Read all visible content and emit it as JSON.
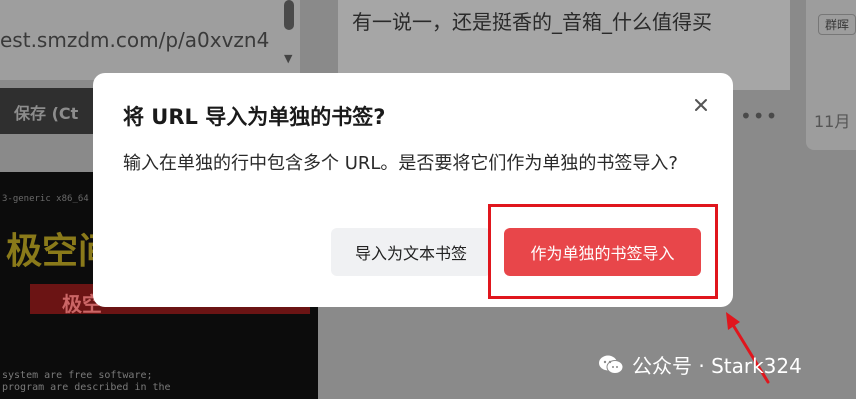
{
  "background": {
    "url_text": "est.smzdm.com/p/a0xvzn4",
    "save_label": "保存 (Ct",
    "thumbnail": {
      "top_text": "3-generic x86_64",
      "title": "极空间",
      "subtitle": "极空",
      "line1": "system are free software;",
      "line2": "program are described in the"
    },
    "mid_card_title": "有一说一，还是挺香的_音箱_什么值得买",
    "more_label": "•••",
    "right_card": {
      "tag": "群晖",
      "date": "11月"
    }
  },
  "dialog": {
    "title": "将 URL 导入为单独的书签?",
    "message": "输入在单独的行中包含多个 URL。是否要将它们作为单独的书签导入?",
    "secondary_button": "导入为文本书签",
    "primary_button": "作为单独的书签导入"
  },
  "watermark": {
    "text": "公众号 · Stark324"
  },
  "colors": {
    "primary": "#e8464a",
    "highlight": "#e0161d",
    "overlay": "#8a8a8a"
  },
  "icons": {
    "close": "close-icon",
    "watermark": "wechat-icon"
  }
}
